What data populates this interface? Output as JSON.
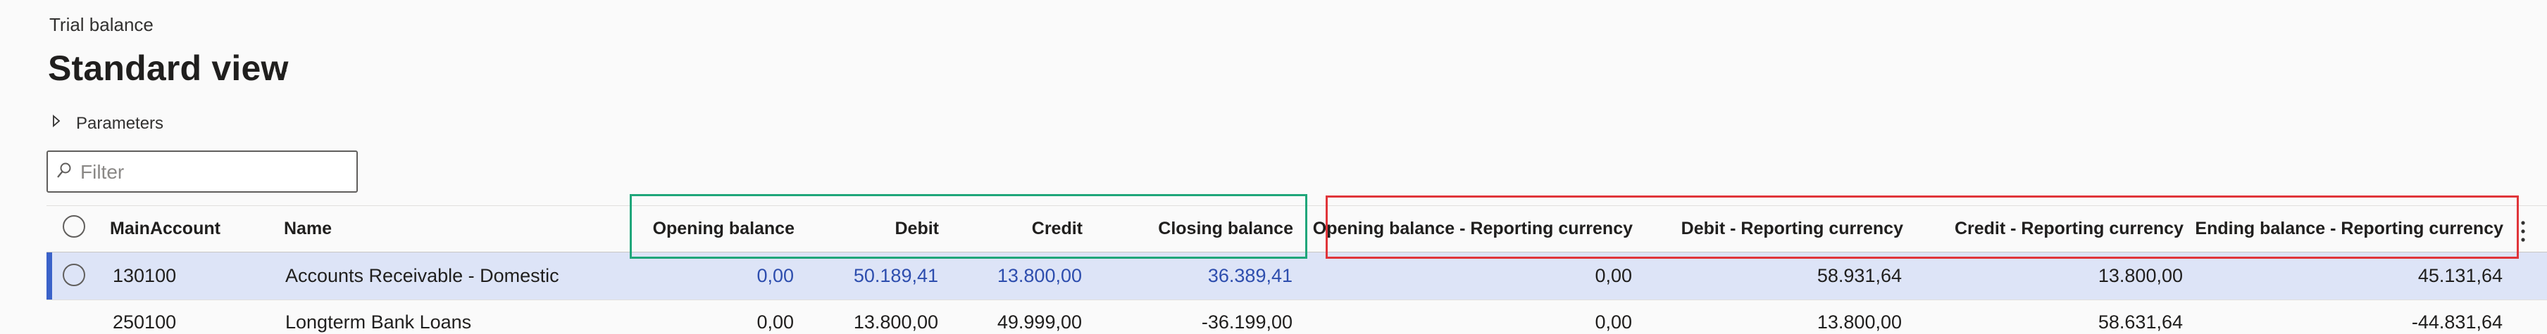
{
  "page": {
    "caption": "Trial balance",
    "view_title": "Standard view",
    "parameters_label": "Parameters",
    "filter_placeholder": "Filter"
  },
  "grid": {
    "columns": {
      "main_account": "MainAccount",
      "name": "Name",
      "opening_balance": "Opening balance",
      "debit": "Debit",
      "credit": "Credit",
      "closing_balance": "Closing balance",
      "opening_balance_rc": "Opening balance - Reporting currency",
      "debit_rc": "Debit - Reporting currency",
      "credit_rc": "Credit - Reporting currency",
      "ending_balance_rc": "Ending balance - Reporting currency"
    },
    "rows": [
      {
        "main_account": "130100",
        "name": "Accounts Receivable - Domestic",
        "opening_balance": "0,00",
        "debit": "50.189,41",
        "credit": "13.800,00",
        "closing_balance": "36.389,41",
        "opening_balance_rc": "0,00",
        "debit_rc": "58.931,64",
        "credit_rc": "13.800,00",
        "ending_balance_rc": "45.131,64",
        "selected": true
      },
      {
        "main_account": "250100",
        "name": "Longterm Bank Loans",
        "opening_balance": "0,00",
        "debit": "13.800,00",
        "credit": "49.999,00",
        "closing_balance": "-36.199,00",
        "opening_balance_rc": "0,00",
        "debit_rc": "13.800,00",
        "credit_rc": "58.631,64",
        "ending_balance_rc": "-44.831,64",
        "selected": false
      }
    ]
  },
  "annotations": {
    "green_box_color": "#1fa67a",
    "red_box_color": "#e0353a"
  },
  "colors": {
    "selected_row": "#dde4f7",
    "selection_accent": "#3a62c9",
    "link_text": "#2e4eae"
  },
  "icons": {
    "view_chevron": "chevron-down-icon",
    "parameters_toggle": "caret-right-icon",
    "filter": "search-icon",
    "column_options": "more-vertical-icon"
  }
}
